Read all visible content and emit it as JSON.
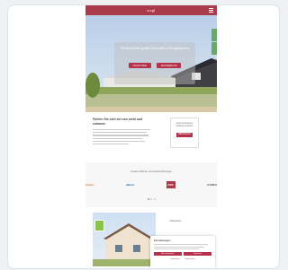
{
  "header": {
    "logo": "ziegl"
  },
  "hero": {
    "title": "Deutschlands größte Auswahl an Fertighäusern",
    "button_left": "HAUSTYPEN",
    "button_right": "MUSTERHAUS"
  },
  "intro": {
    "title": "Fühlen Sie sich bei uns wohl und zuhause",
    "box_text": "Jetzt kostenlosen Katalog bestellen",
    "box_button": "BESTELLEN"
  },
  "partners": {
    "title": "Unsere Partner und Auszeichnungen",
    "logos": [
      "Finanz",
      "allianz",
      "BDF",
      "KAMEX"
    ]
  },
  "featured": {
    "text": "Hausplaner"
  },
  "cookie": {
    "title": "Einstellungen",
    "accept": "Alle akzeptieren",
    "save": "Speichern",
    "link1": "Impressum",
    "link2": "Datenschutz"
  }
}
